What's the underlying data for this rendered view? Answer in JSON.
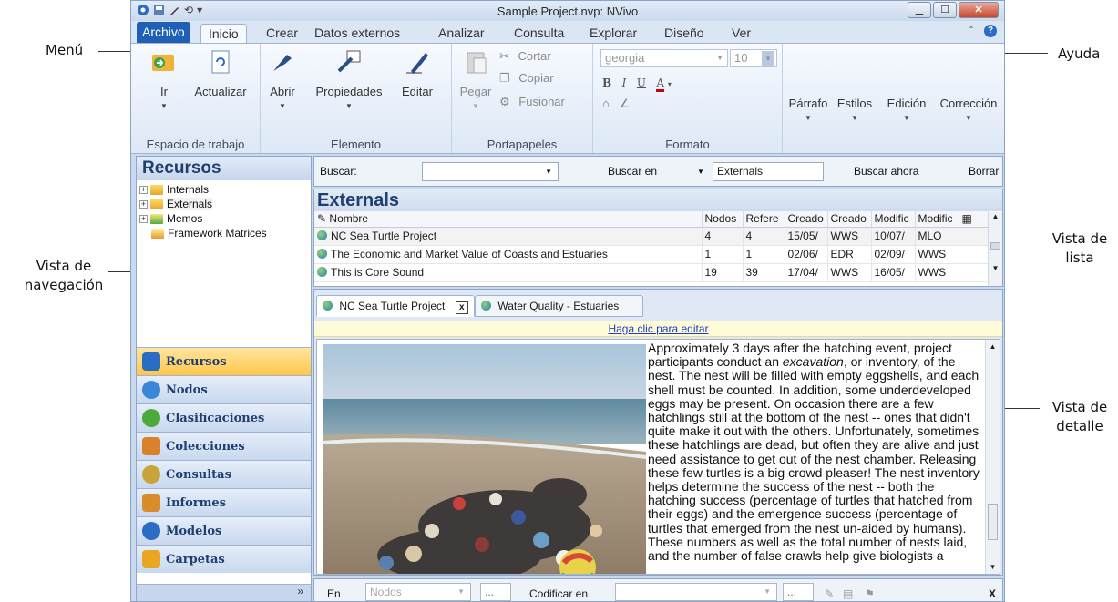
{
  "callouts": {
    "menu": "Menú",
    "help": "Ayuda",
    "nav_view_1": "Vista de",
    "nav_view_2": "navegación",
    "list_view_1": "Vista de",
    "list_view_2": "lista",
    "detail_view_1": "Vista de",
    "detail_view_2": "detalle"
  },
  "window": {
    "title": "Sample Project.nvp: NVivo",
    "qat": [
      "⟲",
      "▾"
    ]
  },
  "ribbon_tabs": {
    "file": "Archivo",
    "items": [
      "Inicio",
      "Crear",
      "Datos externos",
      "Analizar",
      "Consulta",
      "Explorar",
      "Diseño",
      "Ver"
    ]
  },
  "ribbon": {
    "workspace": {
      "go": "Ir",
      "refresh": "Actualizar",
      "label": "Espacio de trabajo"
    },
    "element": {
      "open": "Abrir",
      "properties": "Propiedades",
      "edit": "Editar",
      "label": "Elemento"
    },
    "clipboard": {
      "paste": "Pegar",
      "cut": "Cortar",
      "copy": "Copiar",
      "merge": "Fusionar",
      "label": "Portapapeles"
    },
    "format": {
      "font": "georgia",
      "size": "10",
      "label": "Formato"
    },
    "paragraph": "Párrafo",
    "styles": "Estilos",
    "editing": "Edición",
    "correction": "Corrección"
  },
  "nav": {
    "title": "Recursos",
    "tree": [
      "Internals",
      "Externals",
      "Memos",
      "Framework Matrices"
    ],
    "buttons": [
      "Recursos",
      "Nodos",
      "Clasificaciones",
      "Colecciones",
      "Consultas",
      "Informes",
      "Modelos",
      "Carpetas"
    ],
    "colors": [
      "#2b6cc4",
      "#3a86d8",
      "#4caa3a",
      "#d9822b",
      "#c9a43a",
      "#d98c2b",
      "#2b6cc4",
      "#e8a623"
    ],
    "footer": "»"
  },
  "search": {
    "label": "Buscar:",
    "search_in": "Buscar en",
    "scope": "Externals",
    "search_now": "Buscar ahora",
    "clear": "Borrar"
  },
  "list": {
    "title": "Externals",
    "columns": [
      "Nombre",
      "Nodos",
      "Refere",
      "Creado",
      "Creado",
      "Modific",
      "Modific"
    ],
    "rows": [
      [
        "NC Sea Turtle Project",
        "4",
        "4",
        "15/05/",
        "WWS",
        "10/07/",
        "MLO"
      ],
      [
        "The Economic and Market Value of Coasts and Estuaries",
        "1",
        "1",
        "02/06/",
        "EDR",
        "02/09/",
        "WWS"
      ],
      [
        "This is Core Sound",
        "19",
        "39",
        "17/04/",
        "WWS",
        "16/05/",
        "WWS"
      ]
    ]
  },
  "detail": {
    "tabs": [
      "NC Sea Turtle Project",
      "Water Quality - Estuaries"
    ],
    "close": "x",
    "edit_prompt": "Haga clic para editar",
    "text_before": "Approximately 3 days after the hatching event, project participants conduct an ",
    "text_emph": "excavation",
    "text_after": ", or inventory, of the nest. The nest will be filled with empty eggshells, and each shell must be counted. In addition, some underdeveloped eggs may be present. On occasion there are a few hatchlings still at the bottom of the nest -- ones that didn't quite make it out with the others. Unfortunately, sometimes these hatchlings are dead, but often they are alive and just need assistance to get out of the nest chamber. Releasing these few turtles is a big crowd pleaser! The nest inventory helps determine the success of the nest -- both the hatching success (percentage of turtles that hatched from their eggs) and the emergence success (percentage of turtles that emerged from the nest un-aided by humans). These numbers as well as the total number of nests laid, and the number of false crawls help give biologists a"
  },
  "coding": {
    "in_label": "En",
    "in_value": "Nodos",
    "dots": "...",
    "code_label": "Codificar en",
    "close": "X"
  }
}
